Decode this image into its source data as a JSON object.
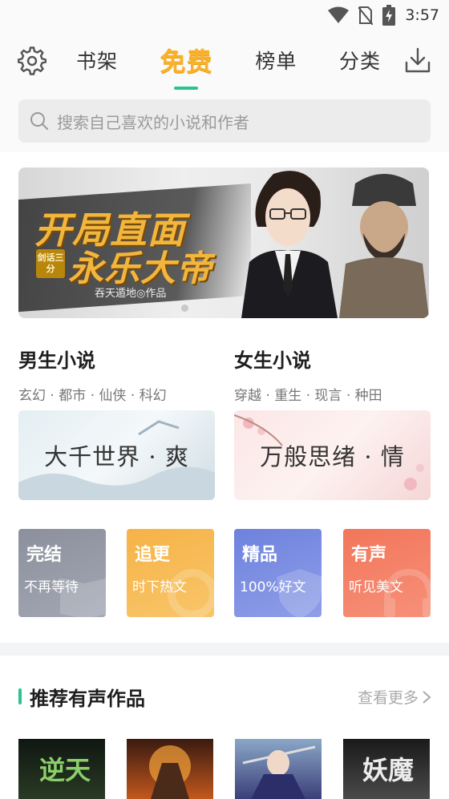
{
  "status": {
    "time": "3:57"
  },
  "header": {
    "tabs": [
      {
        "label": "书架",
        "active": false
      },
      {
        "label": "免费",
        "active": true
      },
      {
        "label": "榜单",
        "active": false
      },
      {
        "label": "分类",
        "active": false
      }
    ]
  },
  "search": {
    "placeholder": "搜索自己喜欢的小说和作者"
  },
  "banner": {
    "title_line1": "开局直面",
    "title_line2": "永乐大帝",
    "badge": "剑话三分",
    "author": "吞天遁地◎作品"
  },
  "genres": [
    {
      "title": "男生小说",
      "tags": "玄幻 · 都市 · 仙侠 · 科幻",
      "mood": "大千世界 · 爽"
    },
    {
      "title": "女生小说",
      "tags": "穿越 · 重生 · 现言 · 种田",
      "mood": "万般思绪 · 情"
    }
  ],
  "categories": [
    {
      "title": "完结",
      "sub": "不再等待",
      "color": "#8b909c"
    },
    {
      "title": "追更",
      "sub": "时下热文",
      "color": "#f6b347"
    },
    {
      "title": "精品",
      "sub": "100%好文",
      "color": "#6d82dd"
    },
    {
      "title": "有声",
      "sub": "听见美文",
      "color": "#f2765a"
    }
  ],
  "recommend": {
    "title": "推荐有声作品",
    "more": "查看更多",
    "books": [
      {
        "cover_text": "逆天"
      },
      {
        "cover_text": ""
      },
      {
        "cover_text": ""
      },
      {
        "cover_text": "妖魔"
      }
    ]
  },
  "colors": {
    "accent": "#2cc38f",
    "active_tab": "#f9b12a"
  }
}
